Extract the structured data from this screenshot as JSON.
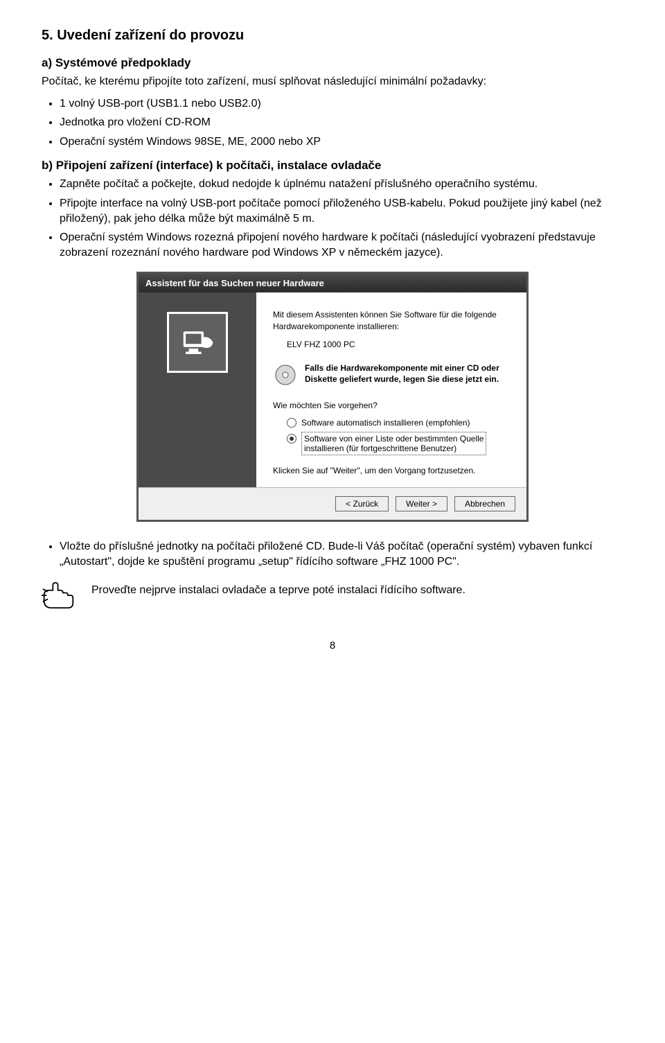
{
  "section": {
    "title": "5. Uvedení zařízení do provozu",
    "subA": {
      "heading": "a) Systémové předpoklady",
      "intro": "Počítač, ke kterému připojíte toto zařízení, musí splňovat následující minimální požadavky:",
      "bullets": [
        "1 volný USB-port (USB1.1 nebo USB2.0)",
        "Jednotka pro vložení CD-ROM",
        "Operační systém Windows 98SE, ME, 2000 nebo XP"
      ]
    },
    "subB": {
      "heading": "b) Připojení zařízení (interface) k počítači, instalace ovladače",
      "bullets": [
        "Zapněte počítač a počkejte, dokud nedojde k úplnému natažení příslušného operačního systému.",
        "Připojte interface na volný USB-port počítače pomocí přiloženého USB-kabelu. Pokud použijete jiný kabel (než přiložený), pak jeho délka může být maximálně 5 m.",
        "Operační systém Windows rozezná připojení nového hardware k počítači (následující vyobrazení představuje zobrazení rozeznání nového hardware pod Windows XP v německém jazyce)."
      ],
      "bullets2": [
        "Vložte do příslušné jednotky na počítači přiložené CD. Bude-li Váš počítač (operační systém) vybaven funkcí „Autostart\", dojde ke spuštění programu „setup\" řídícího software „FHZ 1000 PC\"."
      ],
      "note": "Proveďte nejprve instalaci ovladače a teprve poté instalaci řídícího software."
    }
  },
  "wizard": {
    "title": "Assistent für das Suchen neuer Hardware",
    "intro": "Mit diesem Assistenten können Sie Software für die folgende Hardwarekomponente installieren:",
    "device": "ELV FHZ 1000 PC",
    "cdHint": "Falls die Hardwarekomponente mit einer CD oder Diskette geliefert wurde, legen Sie diese jetzt ein.",
    "question": "Wie möchten Sie vorgehen?",
    "opt1": "Software automatisch installieren (empfohlen)",
    "opt2a": "Software von einer Liste oder bestimmten Quelle",
    "opt2b": "installieren (für fortgeschrittene Benutzer)",
    "continue": "Klicken Sie auf \"Weiter\", um den Vorgang fortzusetzen.",
    "btnBack": "< Zurück",
    "btnNext": "Weiter >",
    "btnCancel": "Abbrechen"
  },
  "pageNumber": "8"
}
